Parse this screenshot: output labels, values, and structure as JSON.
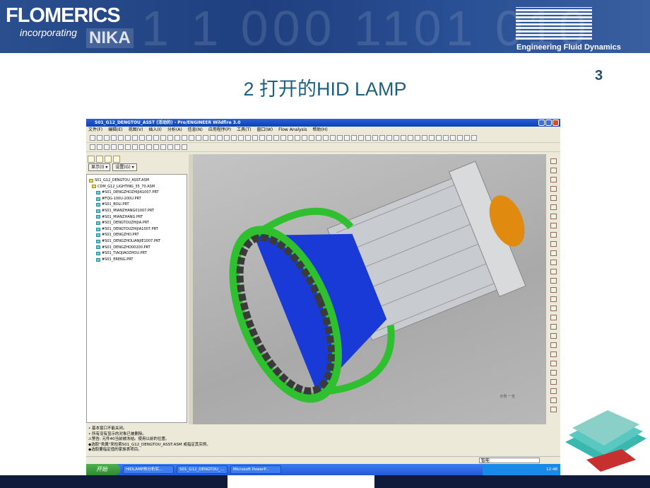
{
  "header": {
    "company": "FLOMERICS",
    "incorporating": "incorporating",
    "partner": "NIKA",
    "efd_tagline": "Engineering Fluid Dynamics",
    "bg_digits": "1 1 000 1101 010"
  },
  "slide": {
    "title": "2 打开的HID LAMP",
    "page_number": "3"
  },
  "window": {
    "title": "S01_G12_DENGTOU_ASST (活动的) - Pro/ENGINEER Wildfire 3.0",
    "menu": [
      "文件(F)",
      "编辑(E)",
      "视图(V)",
      "插入(I)",
      "分析(A)",
      "信息(N)",
      "应用程序(P)",
      "工具(T)",
      "窗口(W)",
      "Flow Analysis",
      "帮助(H)"
    ],
    "panel_buttons": [
      "显示(I) ▾",
      "设置(G) ▾"
    ],
    "tree": [
      "S01_G12_DENGTOU_ASST.ASM",
      "CDM_G12_LIGHTING_35_70.ASM",
      "#S01_DENGZHOZHIJIA1007.PRT",
      "#FQG-100U-200U.PRT",
      "#S01_BOLI.PRT",
      "#S01_MIANZHANG01007.PRT",
      "#S01_MIANZHANG.PRT",
      "#S01_DENGTOUZHIJIA.PRT",
      "#S01_DENGTOUZHIJIA1007.PRT",
      "#S01_DENGZHO.PRT",
      "#S01_DENGZHOLIANJIE1007.PRT",
      "#S01_DENGZHO00200.PRT",
      "#S01_TIAOJIAOZHOU.PRT",
      "#S01_ERENG.PRT"
    ],
    "viewport_label": "示例 一览",
    "messages": [
      "• 基本窗口不能关闭。",
      "• 所有没有显示的对象已被删除。",
      "⚠警告: 元件40当前被冻结。使用以前的位置。",
      "◆选取\"类属\"来检索S01_G12_DENGTOU_ASST.ASM 或指定其实例。",
      "◆选取要指定值的家族表项目。"
    ],
    "status_select": "智能"
  },
  "taskbar": {
    "start": "开始",
    "items": [
      "HIDLAMP热分析实...",
      "S01_G12_DENGTOU_...",
      "Microsoft PowerP..."
    ],
    "clock": "12:48"
  },
  "colors": {
    "title": "#1f5f7f",
    "banner": "#1f3f7f",
    "lamp_green": "#2fc02f",
    "reflector_blue": "#1a3ad8",
    "cap_orange": "#e08a10"
  }
}
